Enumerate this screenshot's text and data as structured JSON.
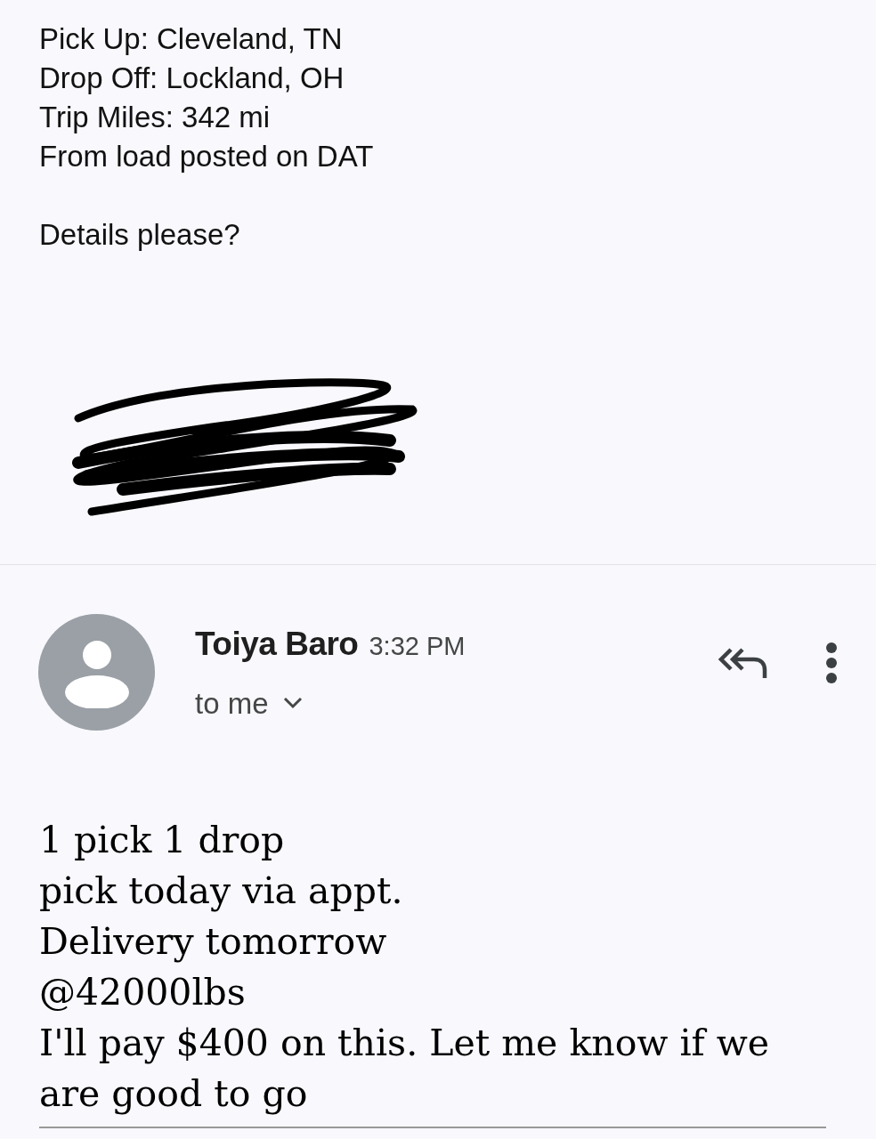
{
  "previous_message": {
    "lines": [
      "Pick Up: Cleveland, TN",
      "Drop Off: Lockland, OH",
      "Trip Miles: 342 mi",
      "From load posted on DAT"
    ],
    "question": "Details please?"
  },
  "message": {
    "sender": "Toiya Baro",
    "time": "3:32 PM",
    "recipient": "to me",
    "body": [
      "1 pick 1 drop",
      "pick today via appt.",
      "Delivery tomorrow",
      "@42000lbs",
      "I'll pay $400 on this. Let me know if we are good to go"
    ]
  }
}
